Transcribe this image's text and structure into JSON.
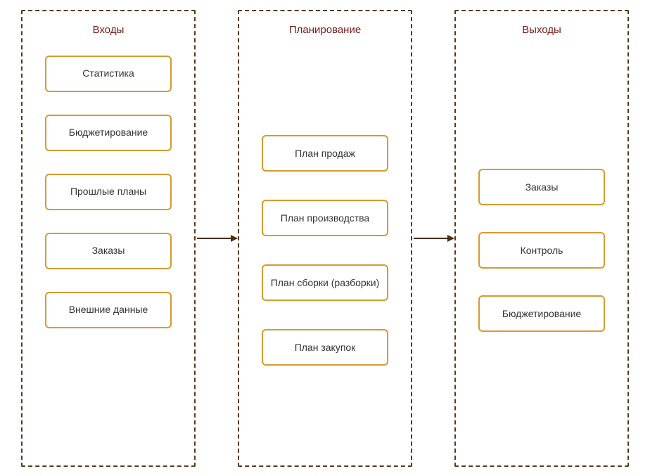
{
  "columns": {
    "inputs": {
      "title": "Входы",
      "items": [
        "Статистика",
        "Бюджетирование",
        "Прошлые планы",
        "Заказы",
        "Внешние данные"
      ]
    },
    "planning": {
      "title": "Планирование",
      "items": [
        "План продаж",
        "План производства",
        "План сборки (разборки)",
        "План закупок"
      ]
    },
    "outputs": {
      "title": "Выходы",
      "items": [
        "Заказы",
        "Контроль",
        "Бюджетирование"
      ]
    }
  }
}
